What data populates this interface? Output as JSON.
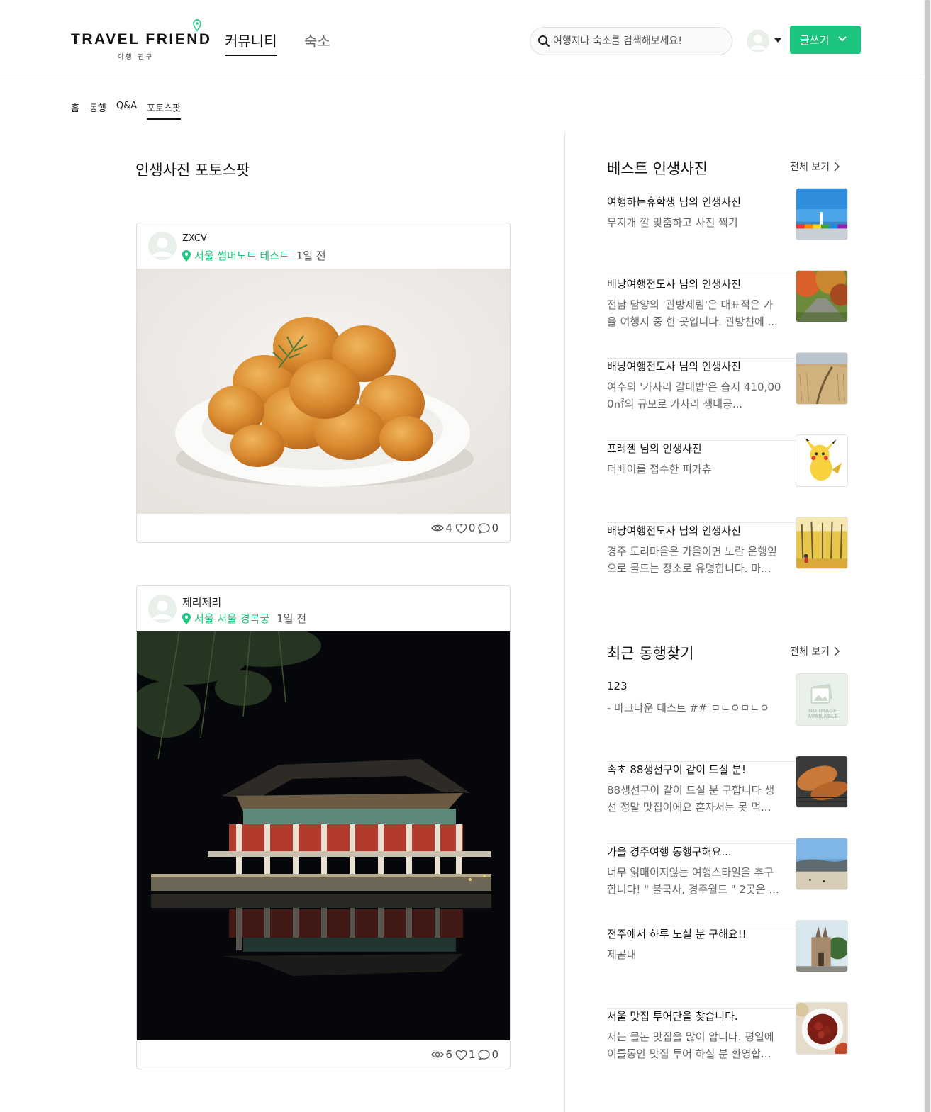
{
  "header": {
    "logo_text": "TRAVEL FRIEND",
    "logo_sub": "여행 친구",
    "nav": [
      {
        "label": "커뮤니티",
        "active": true
      },
      {
        "label": "숙소",
        "active": false
      }
    ],
    "search_placeholder": "여행지나 숙소를 검색해보세요!",
    "write_label": "글쓰기",
    "accent": "#1cc47d"
  },
  "subnav": [
    "홈",
    "동행",
    "Q&A",
    "포토스팟"
  ],
  "page_title": "인생사진 포토스팟",
  "posts": [
    {
      "author": "ZXCV",
      "location": "서울 썸머노트 테스트",
      "time": "1일 전",
      "views": "4",
      "likes": "0",
      "comments": "0"
    },
    {
      "author": "제리제리",
      "location": "서울 서울 경복궁",
      "time": "1일 전",
      "views": "6",
      "likes": "1",
      "comments": "0"
    }
  ],
  "best_photos": {
    "title": "베스트 인생사진",
    "see_all": "전체 보기",
    "items": [
      {
        "title": "여행하는휴학생 님의 인생사진",
        "desc": "무지개 깔 맞춤하고 사진 찍기"
      },
      {
        "title": "배낭여행전도사 님의 인생사진",
        "desc": "전남 담양의 '관방제림'은 대표적은 가을 여행지 중 한 곳입니다. 관방천에 ..."
      },
      {
        "title": "배낭여행전도사 님의 인생사진",
        "desc": "여수의 '가사리 갈대밭'은 습지 410,000㎡의 규모로 가사리 생태공..."
      },
      {
        "title": "프레젤 님의 인생사진",
        "desc": "더베이를 접수한 피카츄"
      },
      {
        "title": "배낭여행전도사 님의 인생사진",
        "desc": "경주 도리마을은 가을이면 노란 은행잎으로 물드는 장소로 유명합니다. 마..."
      }
    ]
  },
  "recent_companions": {
    "title": "최근 동행찾기",
    "see_all": "전체 보기",
    "items": [
      {
        "title": "123",
        "desc": "- 마크다운 테스트 ## ㅁㄴㅇㅁㄴㅇ",
        "no_image_text": "NO IMAGE AVAILABLE"
      },
      {
        "title": "속초 88생선구이 같이 드실 분!",
        "desc": "88생선구이 같이 드실 분 구합니다 생선 정말 맛집이에요 혼자서는 못 먹..."
      },
      {
        "title": "가을 경주여행 동행구해요...",
        "desc": "너무 얽매이지않는 여행스타일을 추구합니다! \" 불국사, 경주월드 \" 2곳은 ..."
      },
      {
        "title": "전주에서 하루 노실 분 구해요!!",
        "desc": "제곧내"
      },
      {
        "title": "서울 맛집 투어단을 찾습니다.",
        "desc": "저는 몰논 맛집을 많이 압니다. 평일에 이틀동안 맛집 투어 하실 분 환영합..."
      }
    ]
  }
}
